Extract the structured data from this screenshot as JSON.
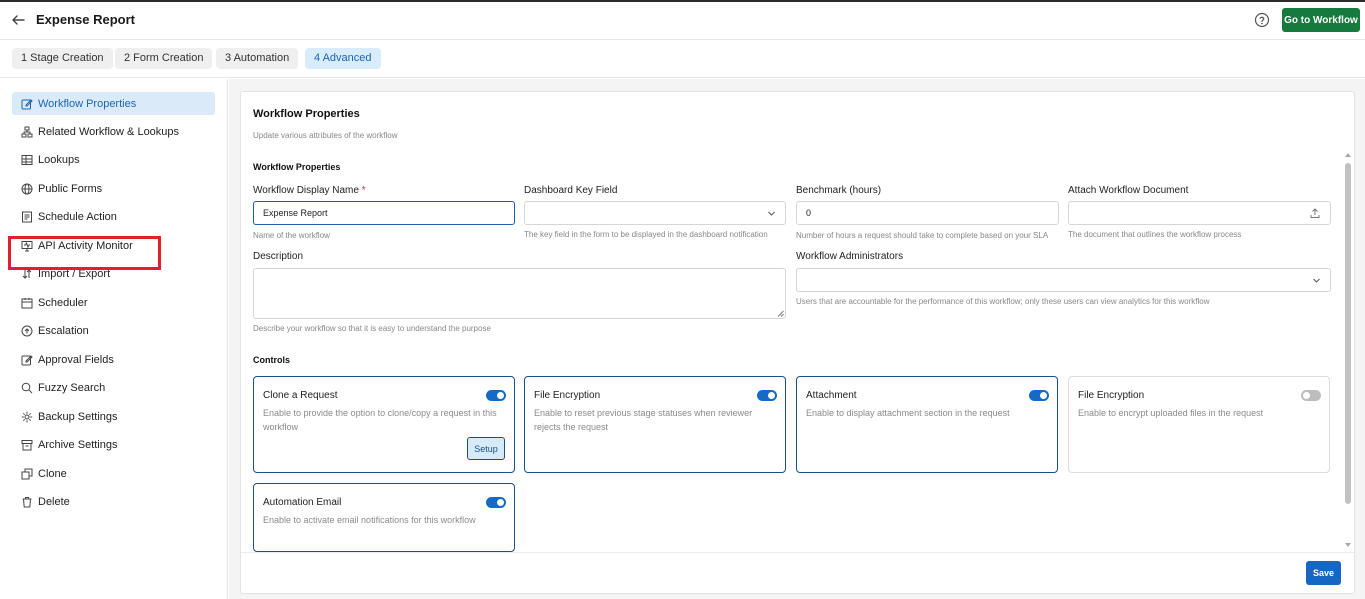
{
  "header": {
    "title": "Expense Report",
    "goto_button": "Go to Workflow"
  },
  "steps": [
    {
      "label": "1  Stage Creation"
    },
    {
      "label": "2  Form Creation"
    },
    {
      "label": "3  Automation"
    },
    {
      "label": "4  Advanced"
    }
  ],
  "sidebar": {
    "items": [
      {
        "label": "Workflow Properties",
        "icon": "edit-icon"
      },
      {
        "label": "Related Workflow & Lookups",
        "icon": "hierarchy-icon"
      },
      {
        "label": "Lookups",
        "icon": "table-icon"
      },
      {
        "label": "Public Forms",
        "icon": "globe-icon"
      },
      {
        "label": "Schedule Action",
        "icon": "document-icon"
      },
      {
        "label": "API Activity Monitor",
        "icon": "monitor-icon"
      },
      {
        "label": "Import / Export",
        "icon": "import-export-icon"
      },
      {
        "label": "Scheduler",
        "icon": "calendar-icon"
      },
      {
        "label": "Escalation",
        "icon": "escalation-icon"
      },
      {
        "label": "Approval Fields",
        "icon": "edit-icon"
      },
      {
        "label": "Fuzzy Search",
        "icon": "search-icon"
      },
      {
        "label": "Backup Settings",
        "icon": "gear-icon"
      },
      {
        "label": "Archive Settings",
        "icon": "archive-icon"
      },
      {
        "label": "Clone",
        "icon": "copy-icon"
      },
      {
        "label": "Delete",
        "icon": "trash-icon"
      }
    ]
  },
  "main": {
    "title": "Workflow Properties",
    "subtitle": "Update various attributes of the workflow",
    "section_title": "Workflow Properties",
    "fields": {
      "display_name": {
        "label": "Workflow Display Name",
        "value": "Expense Report",
        "hint": "Name of the workflow"
      },
      "dashboard_key": {
        "label": "Dashboard Key Field",
        "value": "",
        "hint": "The key field in the form to be displayed in the dashboard notification"
      },
      "benchmark": {
        "label": "Benchmark (hours)",
        "value": "0",
        "hint": "Number of hours a request should take to complete based on your SLA"
      },
      "attach_doc": {
        "label": "Attach Workflow Document",
        "value": "",
        "hint": "The document that outlines the workflow process"
      },
      "description": {
        "label": "Description",
        "hint": "Describe your workflow so that it is easy to understand the purpose"
      },
      "admins": {
        "label": "Workflow Administrators",
        "hint": "Users that are accountable for the performance of this workflow; only these users can view analytics for this workflow"
      }
    },
    "controls_title": "Controls",
    "controls": [
      {
        "title": "Clone a Request",
        "desc": "Enable to provide the option to clone/copy a request in this workflow",
        "enabled": true,
        "button": "Setup"
      },
      {
        "title": "File Encryption",
        "desc": "Enable to reset previous stage statuses when reviewer rejects the request",
        "enabled": true
      },
      {
        "title": "Attachment",
        "desc": "Enable to display attachment section in the request",
        "enabled": true
      },
      {
        "title": "File Encryption",
        "desc": "Enable to encrypt uploaded files in the request",
        "enabled": false
      },
      {
        "title": "Automation Email",
        "desc": "Enable to activate email notifications for this workflow",
        "enabled": true
      }
    ],
    "save_label": "Save"
  },
  "colors": {
    "primary": "#1766c2",
    "success": "#157a3b",
    "highlight": "#e0202a",
    "active_bg": "#dbeaf8"
  }
}
